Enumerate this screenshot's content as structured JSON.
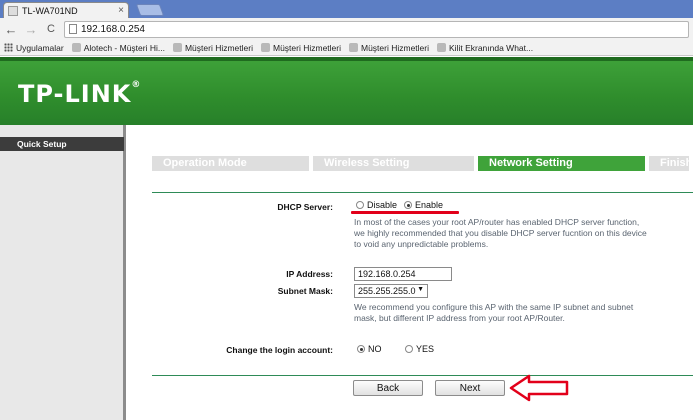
{
  "browser": {
    "tab_title": "TL-WA701ND",
    "tab_close": "×",
    "url": "192.168.0.254",
    "back": "←",
    "forward": "→",
    "reload": "C"
  },
  "bookmarks": [
    {
      "label": "Uygulamalar",
      "icon": "apps-icon"
    },
    {
      "label": "Alotech - Müşteri Hi...",
      "icon": "page-icon"
    },
    {
      "label": "Müşteri Hizmetleri",
      "icon": "cloud-icon"
    },
    {
      "label": "Müşteri Hizmetleri",
      "icon": "cloud-icon"
    },
    {
      "label": "Müşteri Hizmetleri",
      "icon": "cloud-icon"
    },
    {
      "label": "Kilit Ekranında What...",
      "icon": "page-icon"
    }
  ],
  "brand": {
    "logo_text": "TP-LINK",
    "logo_mark": "®"
  },
  "menu": {
    "quick_setup": "Quick Setup"
  },
  "steps": [
    "Operation Mode",
    "Wireless Setting",
    "Network Setting",
    "Finish"
  ],
  "form": {
    "dhcp_label": "DHCP Server:",
    "dhcp_disable": "Disable",
    "dhcp_enable": "Enable",
    "dhcp_note": [
      "In most of the cases your root AP/router has enabled DHCP server function,",
      "we highly recommended that you disable DHCP server fucntion on this device",
      "to void any unpredictable problems."
    ],
    "ip_label": "IP Address:",
    "ip_value": "192.168.0.254",
    "mask_label": "Subnet Mask:",
    "mask_value": "255.255.255.0",
    "mask_note": [
      "We recommend you configure this AP with the same IP subnet and subnet",
      "mask, but different IP address from your root AP/Router."
    ],
    "login_label": "Change the login account:",
    "login_no": "NO",
    "login_yes": "YES",
    "back_button": "Back",
    "next_button": "Next"
  },
  "colors": {
    "brand_green": "#3fa33a",
    "annotation_red": "#e2001a"
  }
}
